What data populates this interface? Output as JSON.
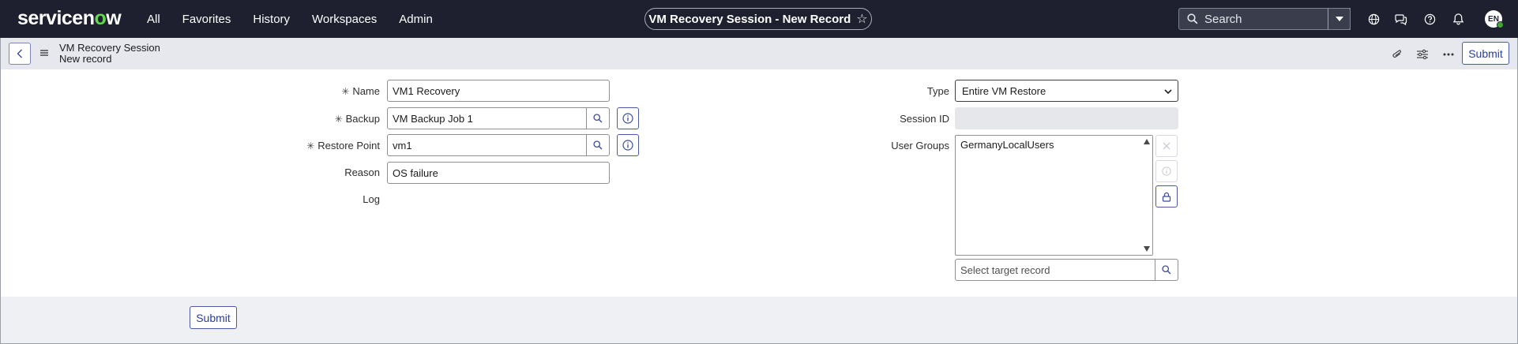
{
  "topbar": {
    "logo_text": "servicenow",
    "nav": [
      "All",
      "Favorites",
      "History",
      "Workspaces",
      "Admin"
    ],
    "record_title": "VM Recovery Session - New Record",
    "star_icon": "star-icon",
    "search_placeholder": "Search",
    "icons": [
      "globe-icon",
      "chat-icon",
      "help-icon",
      "bell-icon"
    ],
    "avatar_initials": "EN",
    "avatar_status_color": "#3fa535"
  },
  "subheader": {
    "title": "VM Recovery Session",
    "subtitle": "New record",
    "submit_label": "Submit",
    "icons": [
      "attachment-icon",
      "settings-sliders-icon",
      "more-icon"
    ]
  },
  "form": {
    "name": {
      "label": "Name",
      "value": "VM1 Recovery",
      "required": true
    },
    "backup": {
      "label": "Backup",
      "value": "VM  Backup Job 1",
      "required": true
    },
    "restore_point": {
      "label": "Restore Point",
      "value": "vm1",
      "required": true
    },
    "reason": {
      "label": "Reason",
      "value": "OS failure"
    },
    "log": {
      "label": "Log"
    },
    "type": {
      "label": "Type",
      "value": "Entire VM Restore"
    },
    "session_id": {
      "label": "Session ID",
      "value": ""
    },
    "user_groups": {
      "label": "User Groups",
      "items": [
        "GermanyLocalUsers"
      ]
    },
    "target_record": {
      "placeholder": "Select target record"
    },
    "required_marker": "✳"
  },
  "footer": {
    "submit_label": "Submit"
  },
  "colors": {
    "topbar_bg": "#1e2030",
    "subheader_bg": "#e6e8ee",
    "accent": "#293e9a",
    "logo_accent": "#62d84e"
  }
}
